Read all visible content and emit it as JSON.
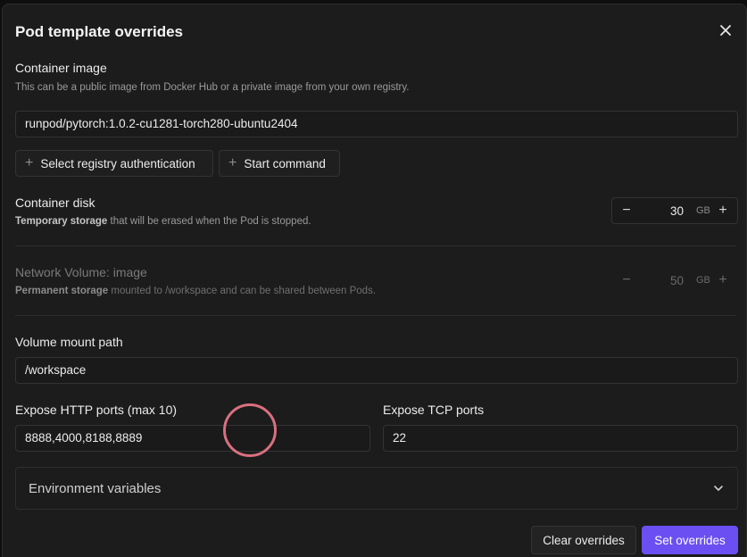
{
  "dialog": {
    "title": "Pod template overrides",
    "close_icon": "close-icon"
  },
  "container_image": {
    "label": "Container image",
    "hint": "This can be a public image from Docker Hub or a private image from your own registry.",
    "value": "runpod/pytorch:1.0.2-cu1281-torch280-ubuntu2404"
  },
  "buttons": {
    "registry_auth": "Select registry authentication",
    "start_command": "Start command",
    "plus_icon": "plus-icon"
  },
  "container_disk": {
    "label": "Container disk",
    "hint_bold": "Temporary storage",
    "hint_rest": " that will be erased when the Pod is stopped.",
    "value": "30",
    "unit": "GB",
    "minus": "−",
    "plus": "+"
  },
  "network_volume": {
    "label": "Network Volume: image",
    "hint_bold": "Permanent storage",
    "hint_rest": " mounted to /workspace and can be shared between Pods.",
    "value": "50",
    "unit": "GB",
    "minus": "−",
    "plus": "+",
    "disabled": true
  },
  "volume_mount": {
    "label": "Volume mount path",
    "value": "/workspace"
  },
  "http_ports": {
    "label": "Expose HTTP ports (max 10)",
    "value": "8888,4000,8188,8889"
  },
  "tcp_ports": {
    "label": "Expose TCP ports",
    "value": "22"
  },
  "env_vars": {
    "label": "Environment variables",
    "icon": "chevron-down-icon"
  },
  "footer": {
    "clear_label": "Clear overrides",
    "set_label": "Set overrides"
  },
  "colors": {
    "accent": "#6b4ff2",
    "background": "#1c1c1c",
    "cursor_ring": "#d9707f"
  }
}
